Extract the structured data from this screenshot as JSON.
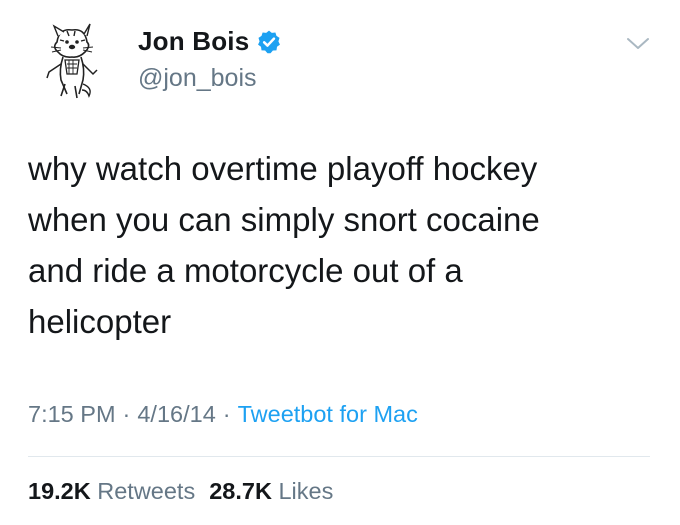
{
  "author": {
    "display_name": "Jon Bois",
    "handle": "@jon_bois",
    "verified": true,
    "avatar_icon": "cartoon-tiger-avatar",
    "verified_icon": "verified-badge-icon"
  },
  "menu_icon": "chevron-down-icon",
  "tweet": {
    "lines": [
      "why watch overtime playoff hockey",
      "when you can simply snort cocaine",
      "and ride a motorcycle out of a",
      "helicopter"
    ]
  },
  "meta": {
    "time": "7:15 PM",
    "date": "4/16/14",
    "separator": "·",
    "source": "Tweetbot for Mac"
  },
  "stats": {
    "retweets_count": "19.2K",
    "retweets_label": "Retweets",
    "likes_count": "28.7K",
    "likes_label": "Likes"
  },
  "colors": {
    "text": "#14171a",
    "secondary": "#657786",
    "link": "#1da1f2",
    "divider": "#e1e8ed"
  }
}
